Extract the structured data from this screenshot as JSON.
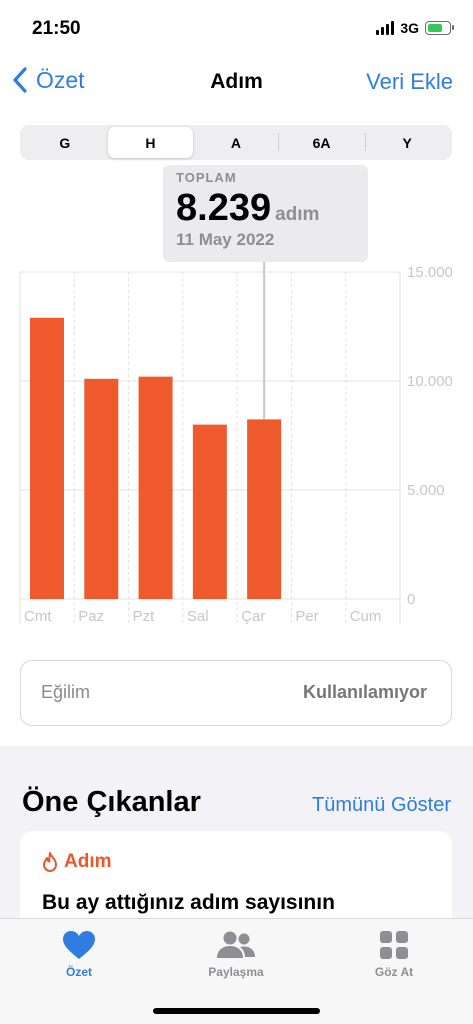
{
  "status_bar": {
    "time": "21:50",
    "network": "3G"
  },
  "nav": {
    "back_label": "Özet",
    "title": "Adım",
    "action_label": "Veri Ekle"
  },
  "segments": [
    {
      "label": "G",
      "selected": false
    },
    {
      "label": "H",
      "selected": true
    },
    {
      "label": "A",
      "selected": false
    },
    {
      "label": "6A",
      "selected": false
    },
    {
      "label": "Y",
      "selected": false
    }
  ],
  "callout": {
    "label": "TOPLAM",
    "value": "8.239",
    "unit": "adım",
    "date": "11 May 2022"
  },
  "chart_data": {
    "type": "bar",
    "categories": [
      "Cmt",
      "Paz",
      "Pzt",
      "Sal",
      "Çar",
      "Per",
      "Cum"
    ],
    "values": [
      12900,
      10100,
      10200,
      8000,
      8239,
      null,
      null
    ],
    "ylim": [
      0,
      15000
    ],
    "yticks": [
      0,
      5000,
      10000,
      15000
    ],
    "ytick_labels": [
      "0",
      "5.000",
      "10.000",
      "15.000"
    ],
    "highlighted_category": "Çar",
    "bar_color": "#ee5a2c",
    "grid": true
  },
  "trend": {
    "label": "Eğilim",
    "value": "Kullanılamıyor"
  },
  "highlights": {
    "title": "Öne Çıkanlar",
    "link_label": "Tümünü Göster",
    "card": {
      "category": "Adım",
      "text": "Bu ay attığınız adım sayısının"
    }
  },
  "tab_bar": {
    "items": [
      {
        "label": "Özet",
        "icon": "heart-icon",
        "active": true
      },
      {
        "label": "Paylaşma",
        "icon": "people-icon",
        "active": false
      },
      {
        "label": "Göz At",
        "icon": "grid-icon",
        "active": false
      }
    ]
  },
  "colors": {
    "accent": "#2f7de1",
    "bar": "#ee5a2c",
    "inactive": "#8e8e93"
  }
}
